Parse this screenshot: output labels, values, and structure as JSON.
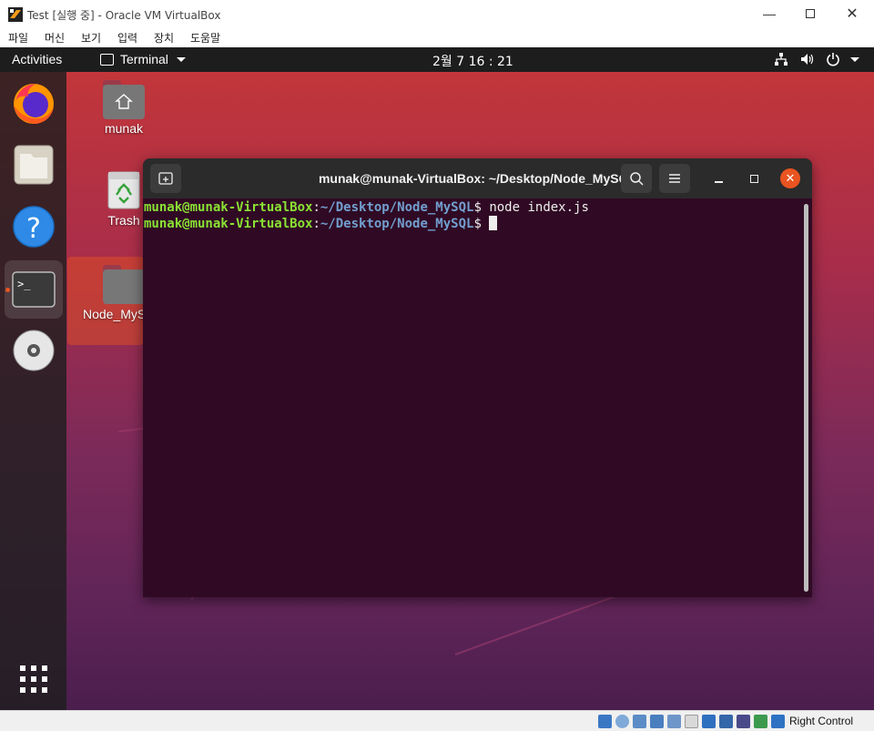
{
  "vbox": {
    "title": "Test [실행 중] - Oracle VM VirtualBox",
    "menu": [
      "파일",
      "머신",
      "보기",
      "입력",
      "장치",
      "도움말"
    ],
    "host_key": "Right Control"
  },
  "topbar": {
    "activities": "Activities",
    "app_name": "Terminal",
    "clock": "2월 7  16 : 21"
  },
  "desktop": {
    "icons": [
      {
        "label": "munak"
      },
      {
        "label": "Trash"
      },
      {
        "label": "Node_MySQL"
      }
    ]
  },
  "terminal": {
    "title": "munak@munak-VirtualBox: ~/Desktop/Node_MySQL",
    "lines": [
      {
        "user": "munak@munak-VirtualBox",
        "sep": ":",
        "path": "~/Desktop/Node_MySQL",
        "prompt": "$",
        "cmd": " node index.js"
      },
      {
        "user": "munak@munak-VirtualBox",
        "sep": ":",
        "path": "~/Desktop/Node_MySQL",
        "prompt": "$",
        "cmd": " "
      }
    ]
  },
  "colors": {
    "accent": "#e95420",
    "terminal_bg": "#300a24",
    "prompt_user": "#8ae234",
    "prompt_path": "#729fcf"
  }
}
